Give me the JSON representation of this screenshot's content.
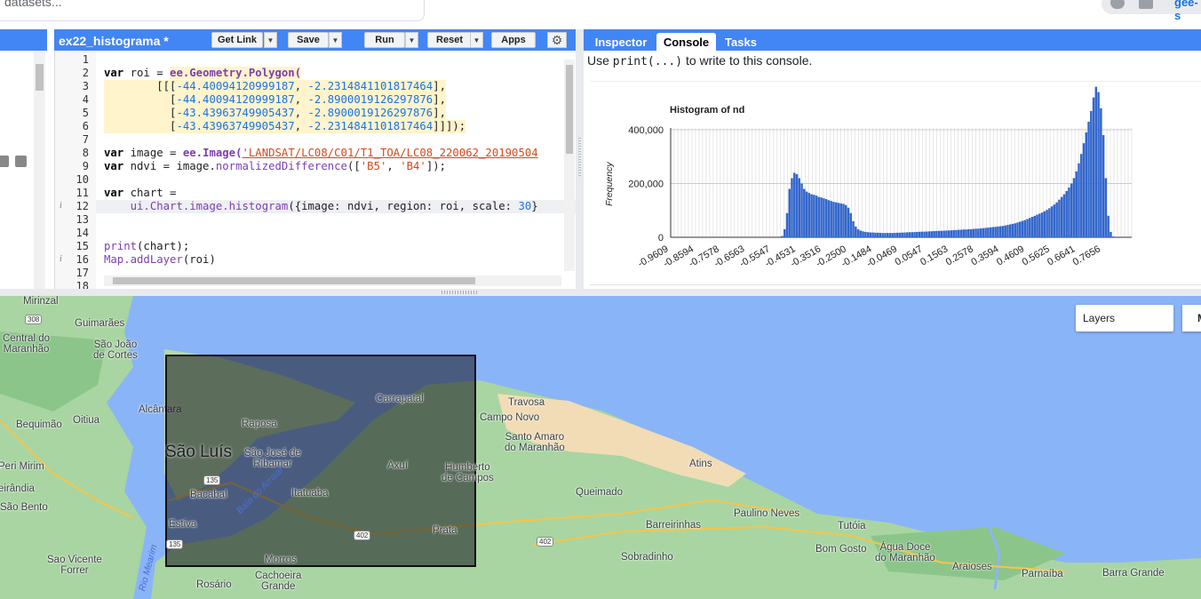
{
  "search": {
    "placeholder": "datasets..."
  },
  "account": {
    "label": "gee-s"
  },
  "editor": {
    "script_name": "ex22_histograma *",
    "buttons": {
      "get_link": "Get Link",
      "save": "Save",
      "run": "Run",
      "reset": "Reset",
      "apps": "Apps"
    },
    "line_numbers": [
      "1",
      "2",
      "3",
      "4",
      "5",
      "6",
      "7",
      "8",
      "9",
      "10",
      "11",
      "12",
      "13",
      "14",
      "15",
      "16",
      "17",
      "18"
    ],
    "code": {
      "l2_a": "var",
      "l2_b": " roi = ",
      "l2_c": "ee.Geometry.Polygon(",
      "l3_a": "        [[[",
      "l3_b": "-44.40094120999187",
      "l3_c": ", ",
      "l3_d": "-2.2314841101817464",
      "l3_e": "],",
      "l4_a": "          [",
      "l4_b": "-44.40094120999187",
      "l4_c": ", ",
      "l4_d": "-2.8900019126297876",
      "l4_e": "],",
      "l5_a": "          [",
      "l5_b": "-43.43963749905437",
      "l5_c": ", ",
      "l5_d": "-2.8900019126297876",
      "l5_e": "],",
      "l6_a": "          [",
      "l6_b": "-43.43963749905437",
      "l6_c": ", ",
      "l6_d": "-2.2314841101817464",
      "l6_e": "]]]);",
      "l8_a": "var",
      "l8_b": " image = ",
      "l8_c": "ee.Image(",
      "l8_d": "'LANDSAT/LC08/C01/T1_TOA/LC08_220062_20190504",
      "l9_a": "var",
      "l9_b": " ndvi = image.",
      "l9_c": "normalizedDifference",
      "l9_d": "([",
      "l9_e": "'B5'",
      "l9_f": ", ",
      "l9_g": "'B4'",
      "l9_h": "]);",
      "l11_a": "var",
      "l11_b": " chart =",
      "l12_a": "    ",
      "l12_b": "ui.Chart.image.histogram",
      "l12_c": "({image: ndvi, region: roi, scale: ",
      "l12_d": "30",
      "l12_e": "}",
      "l15_a": "print",
      "l15_b": "(chart);",
      "l16_a": "Map.addLayer",
      "l16_b": "(roi)"
    },
    "info_marks": {
      "l12": "i",
      "l16": "i"
    }
  },
  "right_panel": {
    "tabs": [
      "Inspector",
      "Console",
      "Tasks"
    ],
    "active_tab": "Console",
    "console_hint_pre": "Use ",
    "console_hint_code": "print(...)",
    "console_hint_post": " to write to this console."
  },
  "chart_data": {
    "type": "bar",
    "title": "Histogram of nd",
    "xlabel": "",
    "ylabel": "Frequency",
    "ylim": [
      0,
      400000
    ],
    "yticks": [
      "400,000",
      "200,000",
      "0"
    ],
    "xticks": [
      "-0.9609",
      "-0.8594",
      "-0.7578",
      "-0.6563",
      "-0.5547",
      "-0.4531",
      "-0.3516",
      "-0.2500",
      "-0.1484",
      "-0.0469",
      "0.0547",
      "0.1563",
      "0.2578",
      "0.3594",
      "0.4609",
      "0.5625",
      "0.6641",
      "0.7656"
    ],
    "bar_color": "#3366cc",
    "x": [
      -0.55,
      -0.54,
      -0.53,
      -0.52,
      -0.51,
      -0.5,
      -0.49,
      -0.48,
      -0.47,
      -0.46,
      -0.45,
      -0.44,
      -0.43,
      -0.42,
      -0.41,
      -0.4,
      -0.39,
      -0.38,
      -0.37,
      -0.36,
      -0.35,
      -0.34,
      -0.33,
      -0.32,
      -0.31,
      -0.3,
      -0.29,
      -0.28,
      -0.27,
      -0.26,
      -0.25,
      -0.24,
      -0.23,
      -0.22,
      -0.21,
      -0.2,
      -0.19,
      -0.18,
      -0.17,
      -0.16,
      -0.15,
      -0.14,
      -0.13,
      -0.12,
      -0.11,
      -0.1,
      -0.09,
      -0.08,
      -0.07,
      -0.06,
      -0.05,
      -0.04,
      -0.03,
      -0.02,
      -0.01,
      0.0,
      0.01,
      0.02,
      0.03,
      0.04,
      0.05,
      0.06,
      0.07,
      0.08,
      0.09,
      0.1,
      0.11,
      0.12,
      0.13,
      0.14,
      0.15,
      0.16,
      0.17,
      0.18,
      0.19,
      0.2,
      0.21,
      0.22,
      0.23,
      0.24,
      0.25,
      0.26,
      0.27,
      0.28,
      0.29,
      0.3,
      0.31,
      0.32,
      0.33,
      0.34,
      0.35,
      0.36,
      0.37,
      0.38,
      0.39,
      0.4,
      0.41,
      0.42,
      0.43,
      0.44,
      0.45,
      0.46,
      0.47,
      0.48,
      0.49,
      0.5,
      0.51,
      0.52,
      0.53,
      0.54,
      0.55,
      0.56,
      0.57,
      0.58,
      0.59,
      0.6,
      0.61,
      0.62,
      0.63,
      0.64,
      0.65,
      0.66,
      0.67,
      0.68,
      0.69,
      0.7,
      0.71,
      0.72,
      0.73,
      0.74,
      0.75,
      0.76,
      0.77,
      0.78,
      0.79,
      0.8,
      0.81,
      0.82
    ],
    "values": [
      5000,
      30000,
      90000,
      180000,
      220000,
      240000,
      235000,
      220000,
      200000,
      180000,
      170000,
      165000,
      160000,
      158000,
      155000,
      150000,
      148000,
      145000,
      142000,
      138000,
      135000,
      132000,
      130000,
      128000,
      126000,
      124000,
      120000,
      110000,
      90000,
      60000,
      40000,
      30000,
      25000,
      22000,
      20000,
      19000,
      18000,
      18000,
      17000,
      17000,
      16500,
      16000,
      16000,
      16000,
      16000,
      16000,
      16500,
      17000,
      17000,
      17500,
      18000,
      18500,
      19000,
      19000,
      19500,
      20000,
      20500,
      21000,
      21000,
      21500,
      22000,
      22500,
      23000,
      23500,
      24000,
      24000,
      24500,
      25000,
      25500,
      26000,
      26500,
      27000,
      28000,
      28000,
      29000,
      29000,
      30000,
      30000,
      31000,
      32000,
      32000,
      33000,
      34000,
      35000,
      36000,
      37000,
      38000,
      39000,
      40000,
      41000,
      42000,
      44000,
      46000,
      48000,
      50000,
      52000,
      55000,
      58000,
      61000,
      64000,
      68000,
      72000,
      76000,
      80000,
      84000,
      88000,
      92000,
      97000,
      102000,
      108000,
      115000,
      122000,
      130000,
      140000,
      150000,
      160000,
      172000,
      185000,
      200000,
      220000,
      245000,
      275000,
      310000,
      350000,
      390000,
      430000,
      470000,
      520000,
      560000,
      540000,
      480000,
      380000,
      220000,
      80000,
      20000,
      3000
    ]
  },
  "map": {
    "layers_label": "Layers",
    "map_type_label": "M",
    "labels": {
      "mirinzal": "Mirinzal",
      "guimaraes": "Guimarães",
      "central_do_maranhao": "Central do\nMaranhão",
      "sao_joao_de_cortes": "São João\nde Cortes",
      "alcantara": "Alcântara",
      "bequimao": "Bequimão",
      "oitiua": "Oitiua",
      "peri_mirim": "Peri Mirim",
      "eirandia": "eirândia",
      "sao_bento": "São Bento",
      "sao_vicente_ferrer": "Sao Vicente\nForrer",
      "sao_luis": "São Luís",
      "raposa": "Raposa",
      "sao_jose_de_ribamar": "São José de\nRibamar",
      "bacabal": "Bacabal",
      "estiva": "Estiva",
      "itatuaba": "Itatuaba",
      "morros": "Morros",
      "rosario": "Rosário",
      "cachoeira_grande": "Cachoeira\nGrande",
      "carrapatal": "Carrapatal",
      "axui": "Axuí",
      "humberto_de_campos": "Humberto\nde Campos",
      "prata": "Prata",
      "travosa": "Travosa",
      "campo_novo": "Campo Novo",
      "santo_amaro": "Santo Amaro\ndo Maranhão",
      "atins": "Atins",
      "queimado": "Queimado",
      "paulino_neves": "Paulino Neves",
      "barreirinhas": "Barreirinhas",
      "tutoia": "Tutóia",
      "sobradinho": "Sobradinho",
      "bom_gosto": "Bom Gosto",
      "agua_doce": "Água Doce\ndo Maranhão",
      "araioses": "Araioses",
      "parnaiba": "Parnaíba",
      "barra_grande": "Barra Grande"
    },
    "water_labels": {
      "baia_do_arraial": "Baía do Arraial",
      "rio_mearim": "Rio Mearim"
    },
    "road_badges": {
      "r308": "308",
      "r135a": "135",
      "r135b": "135",
      "r402a": "402",
      "r402b": "402"
    }
  }
}
